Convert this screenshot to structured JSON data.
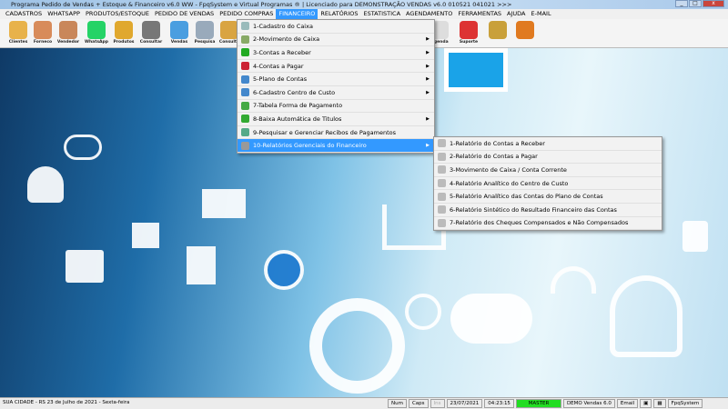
{
  "window": {
    "title": "Programa Pedido de Vendas + Estoque & Financeiro v6.0 WW - FpqSystem e Virtual Programas ® | Licenciado para  DEMONSTRAÇÃO VENDAS v6.0 010521 041021 >>>",
    "minimize": "_",
    "maximize": "□",
    "close": "x"
  },
  "menubar": [
    "CADASTROS",
    "WHATSAPP",
    "PRODUTOS/ESTOQUE",
    "PEDIDO DE VENDAS",
    "PEDIDO COMPRAS",
    "FINANCEIRO",
    "RELATÓRIOS",
    "ESTATISTICA",
    "AGENDAMENTO",
    "FERRAMENTAS",
    "AJUDA",
    "E-MAIL"
  ],
  "toolbar": [
    "Clientes",
    "Forneco",
    "Vendedor",
    "WhatsApp",
    "Produtos",
    "Consultar",
    "Vendas",
    "Pesquisa",
    "Consulta",
    "Agenda",
    "Suporte",
    "",
    ""
  ],
  "financeiro_menu": [
    {
      "label": "1-Cadastro do Caixa",
      "submenu": false,
      "color": "#9bb"
    },
    {
      "label": "2-Movimento de Caixa",
      "submenu": true,
      "color": "#8a6"
    },
    {
      "label": "3-Contas a Receber",
      "submenu": true,
      "color": "#2a2"
    },
    {
      "label": "4-Contas a Pagar",
      "submenu": true,
      "color": "#c23"
    },
    {
      "label": "5-Plano de Contas",
      "submenu": true,
      "color": "#48c"
    },
    {
      "label": "6-Cadastro Centro de Custo",
      "submenu": true,
      "color": "#48c"
    },
    {
      "label": "7-Tabela Forma de Pagamento",
      "submenu": false,
      "color": "#4a4"
    },
    {
      "label": "8-Baixa Automática de Titulos",
      "submenu": true,
      "color": "#3a3"
    },
    {
      "label": "9-Pesquisar e Gerenciar Recibos de Pagamentos",
      "submenu": false,
      "color": "#5a8"
    },
    {
      "label": "10-Relatórios Gerenciais do Financeiro",
      "submenu": true,
      "color": "#999"
    }
  ],
  "relatorios_submenu": [
    "1-Relatório do Contas a Receber",
    "2-Relatório do Contas a Pagar",
    "3-Movimento de Caixa / Conta Corrente",
    "4-Relatório Analítico do Centro de Custo",
    "5-Relatório Analítico das Contas do Plano de Contas",
    "6-Relatório Sintético do Resultado Financeiro das Contas",
    "7-Relatório dos Cheques Compensados e Não Compensados"
  ],
  "status": {
    "city": "SUA CIDADE - RS 23 de Julho de 2021 - Sexta-feira",
    "num": "Num",
    "caps": "Caps",
    "ins": "Ins",
    "date": "23/07/2021",
    "time": "04:23:15",
    "user": "MASTER",
    "version": "DEMO Vendas 6.0",
    "email": "Email",
    "brand": "FpqSystem"
  },
  "colors": {
    "menu_highlight": "#3399ff",
    "master": "#22dd22"
  }
}
